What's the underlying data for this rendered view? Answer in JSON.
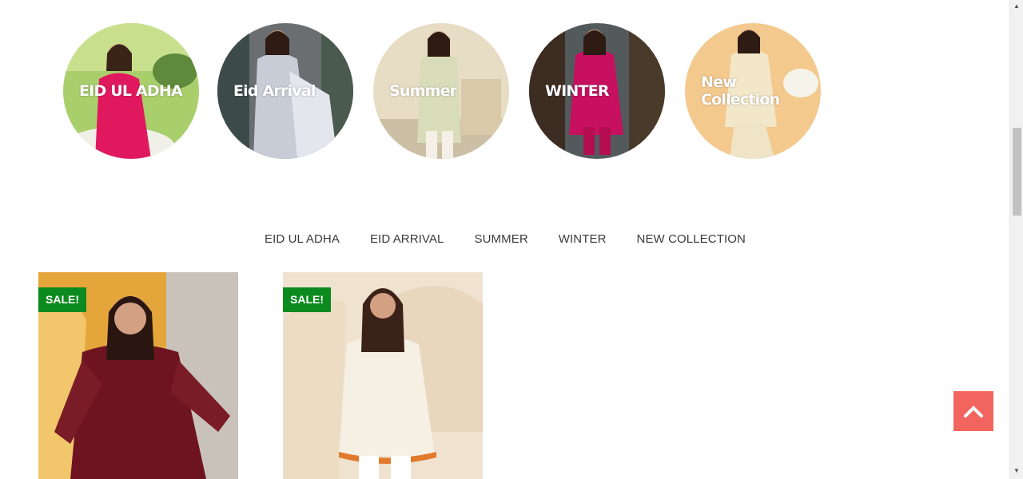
{
  "categories": [
    {
      "label": "EID UL ADHA",
      "bg": "#a9cf6c",
      "dress": "#e0195f",
      "icon": "woman-photo"
    },
    {
      "label": "Eid Arrival",
      "bg": "#6a6e70",
      "dress": "#c8ccd6",
      "icon": "woman-photo"
    },
    {
      "label": "Summer",
      "bg": "#e7dcc4",
      "dress": "#d8dcb8",
      "icon": "woman-photo"
    },
    {
      "label": "WINTER",
      "bg": "#535a5c",
      "dress": "#c7105f",
      "icon": "woman-photo"
    },
    {
      "label": "New Collection",
      "bg": "#f4c98e",
      "dress": "#f2e7c8",
      "icon": "woman-photo"
    }
  ],
  "tabs": [
    "EID UL ADHA",
    "EID ARRIVAL",
    "SUMMER",
    "WINTER",
    "NEW COLLECTION"
  ],
  "products": [
    {
      "badge": "SALE!",
      "bg": "#e4a53a",
      "dress": "#6e1420"
    },
    {
      "badge": "SALE!",
      "bg": "#f1e7d8",
      "dress": "#f6efe4"
    }
  ],
  "colors": {
    "sale_badge": "#0b8a1e",
    "back_to_top": "#f2655e",
    "tab_text": "#3a3a3a"
  },
  "back_to_top": {
    "icon": "chevron-up-icon"
  }
}
